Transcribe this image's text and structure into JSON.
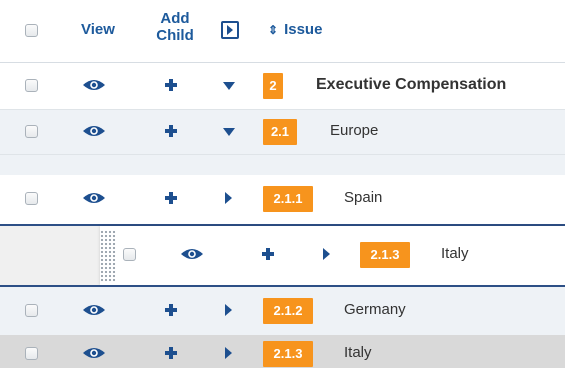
{
  "header": {
    "view_label": "View",
    "add_child_line1": "Add",
    "add_child_line2": "Child",
    "issue_label": "Issue",
    "sort_glyph": "⇕"
  },
  "rows": [
    {
      "badge": "2",
      "label": "Executive Compensation",
      "toggle": "expanded"
    },
    {
      "badge": "2.1",
      "label": "Europe",
      "toggle": "expanded"
    },
    {
      "badge": "2.1.1",
      "label": "Spain",
      "toggle": "collapsed"
    },
    {
      "badge": "2.1.3",
      "label": "Italy",
      "toggle": "collapsed",
      "state": "dragging"
    },
    {
      "badge": "2.1.2",
      "label": "Germany",
      "toggle": "collapsed"
    },
    {
      "badge": "2.1.3",
      "label": "Italy",
      "toggle": "collapsed",
      "state": "hovered"
    }
  ],
  "icons": {
    "view": "eye-icon",
    "add_child": "plus-icon",
    "expanded": "caret-down-icon",
    "collapsed": "caret-right-icon",
    "expand_all": "expand-all-icon",
    "drag": "drag-handle-icon"
  },
  "colors": {
    "accent_blue": "#1d4f8f",
    "badge_orange": "#f7941d",
    "row_alt": "#eef2f6",
    "drop_line": "#2d4f86"
  }
}
